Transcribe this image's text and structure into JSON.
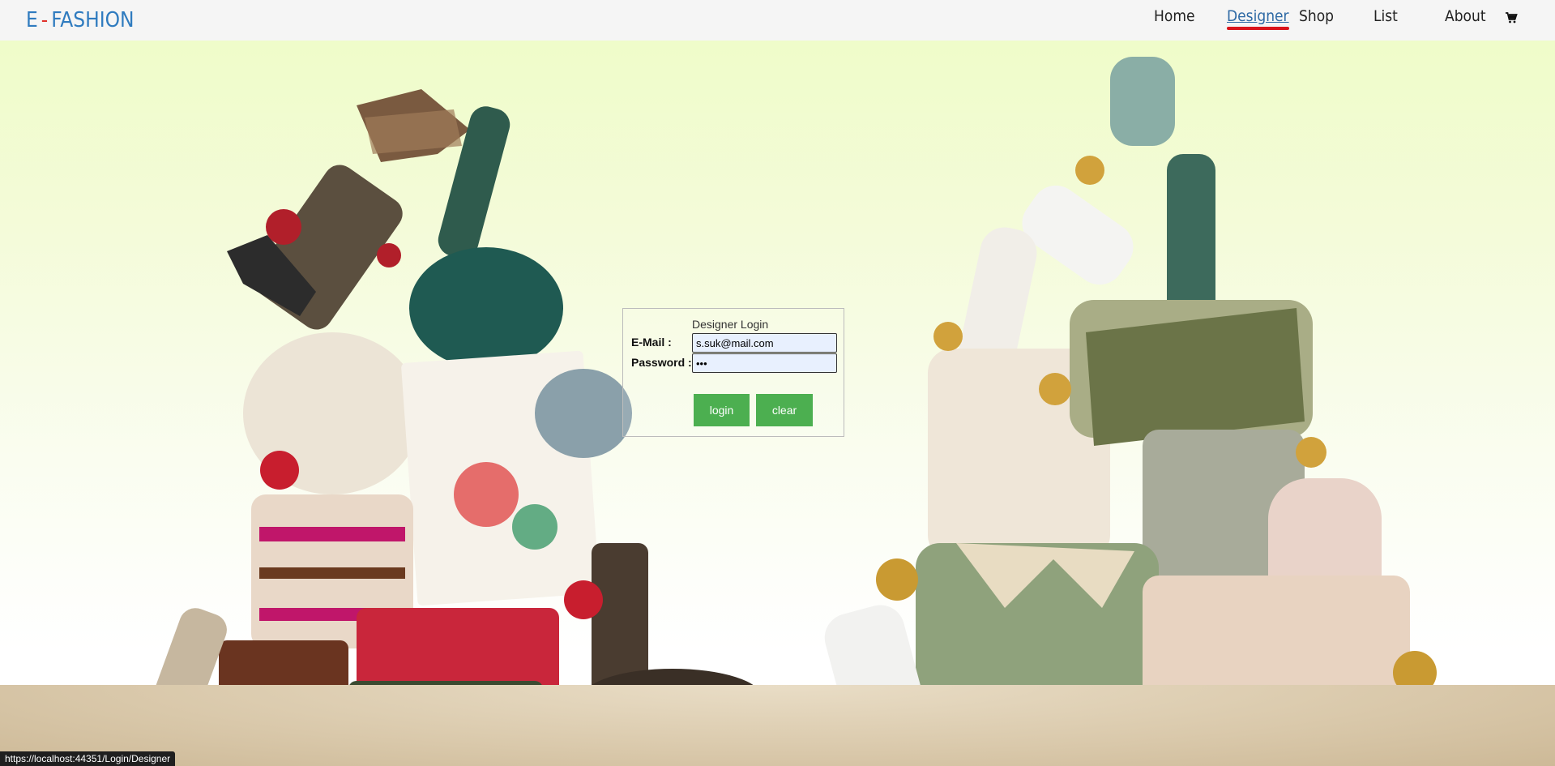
{
  "brand": {
    "left": "E",
    "dash": "-",
    "right": "FASHION"
  },
  "nav": {
    "home": "Home",
    "designer": "Designer",
    "shop": "Shop",
    "list": "List",
    "about": "About",
    "cart_icon": "shopping-cart-icon"
  },
  "login": {
    "title": "Designer Login",
    "email_label": "E-Mail :",
    "email_value": "s.suk@mail.com",
    "password_label": "Password :",
    "password_value": "•••",
    "login_button": "login",
    "clear_button": "clear"
  },
  "status_bar": {
    "url": "https://localhost:44351/Login/Designer"
  },
  "colors": {
    "brand_blue": "#2f7bbf",
    "brand_red": "#e0322c",
    "button_green": "#4caf50",
    "active_underline": "#d9141b"
  }
}
